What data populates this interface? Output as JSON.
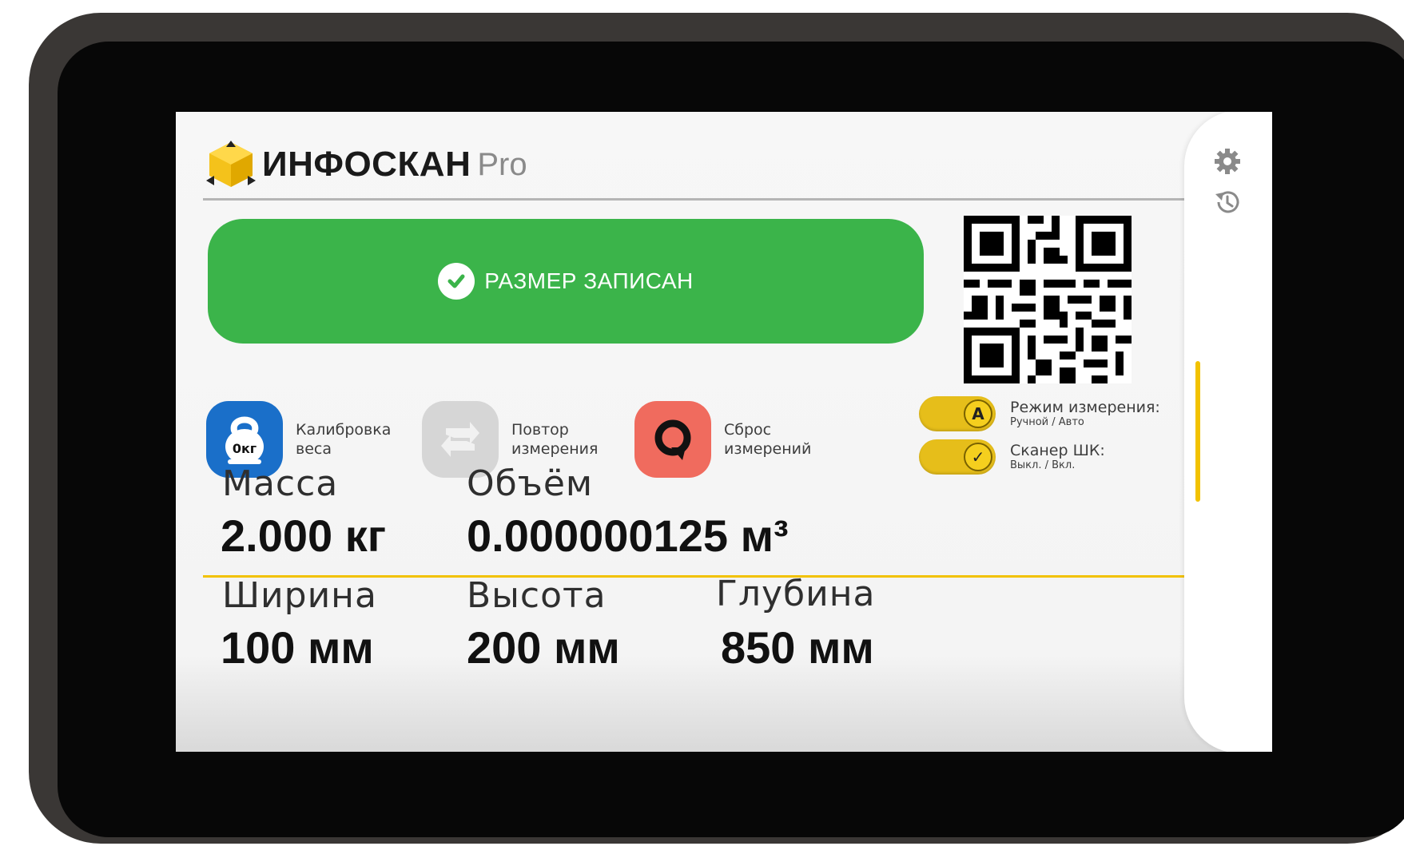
{
  "app": {
    "brand": "ИНФОСКАН",
    "edition": "Pro"
  },
  "status": {
    "text": "РАЗМЕР ЗАПИСАН",
    "color": "#3bb44a"
  },
  "actions": [
    {
      "label_line1": "Калибровка",
      "label_line2": "веса",
      "badge": "0кг",
      "icon": "kettlebell-icon",
      "color": "#1a6fc9"
    },
    {
      "label_line1": "Повтор",
      "label_line2": "измерения",
      "icon": "repeat-icon",
      "color": "#d6d6d6"
    },
    {
      "label_line1": "Сброс",
      "label_line2": "измерений",
      "icon": "reset-icon",
      "color": "#f06b5e"
    }
  ],
  "toggles": {
    "mode": {
      "title": "Режим измерения:",
      "subtitle": "Ручной / Авто",
      "knob": "A",
      "on": true
    },
    "scanner": {
      "title": "Сканер ШК:",
      "subtitle": "Выкл. / Вкл.",
      "knob": "✓",
      "on": true
    }
  },
  "metrics": {
    "mass": {
      "label": "Масса",
      "value": "2.000 кг"
    },
    "volume": {
      "label": "Объём",
      "value": "0.000000125 м³"
    },
    "width": {
      "label": "Ширина",
      "value": "100 мм"
    },
    "height": {
      "label": "Высота",
      "value": "200 мм"
    },
    "depth": {
      "label": "Глубина",
      "value": "850 мм"
    }
  },
  "side": {
    "icons": [
      "gear-icon",
      "history-icon"
    ]
  },
  "colors": {
    "accent_yellow": "#f2c200",
    "success_green": "#3bb44a"
  }
}
